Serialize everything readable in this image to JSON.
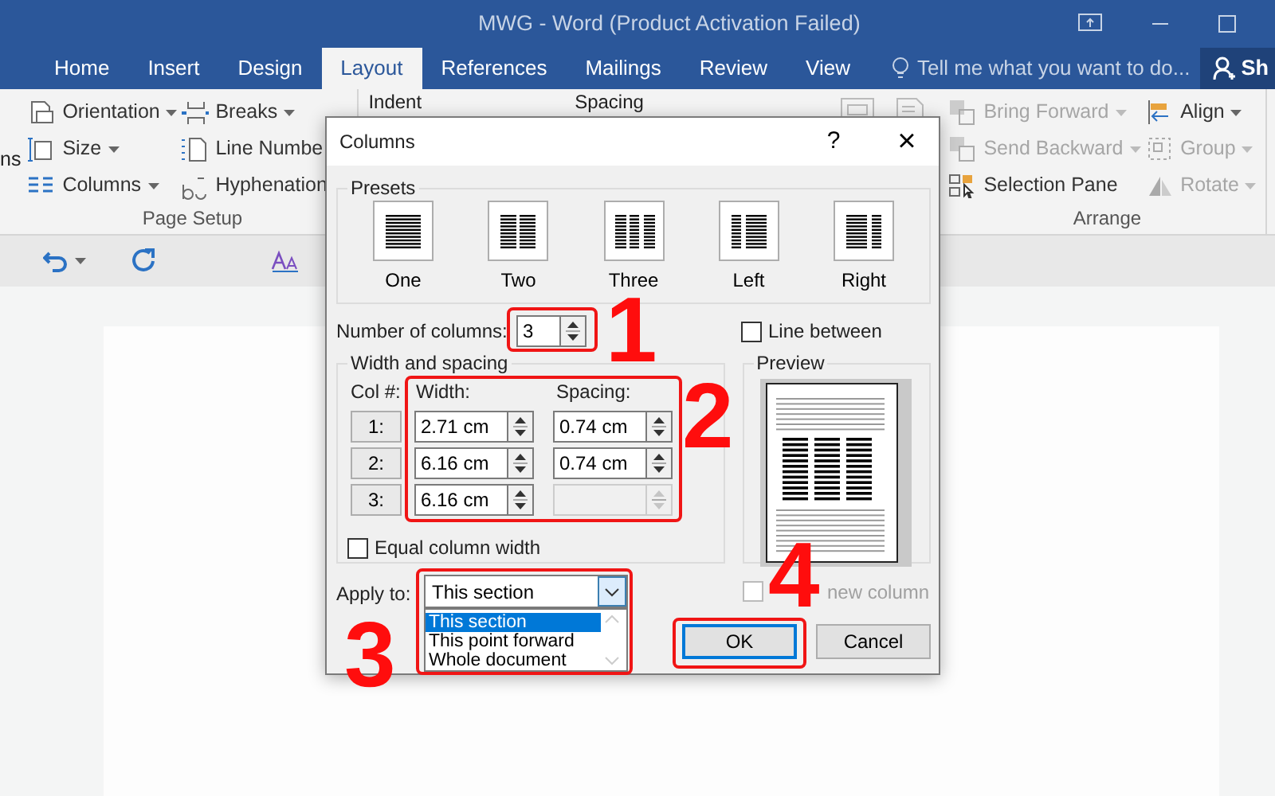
{
  "window": {
    "title": "MWG - Word (Product Activation Failed)"
  },
  "tabs": [
    {
      "label": "Home",
      "selected": false
    },
    {
      "label": "Insert",
      "selected": false
    },
    {
      "label": "Design",
      "selected": false
    },
    {
      "label": "Layout",
      "selected": true
    },
    {
      "label": "References",
      "selected": false
    },
    {
      "label": "Mailings",
      "selected": false
    },
    {
      "label": "Review",
      "selected": false
    },
    {
      "label": "View",
      "selected": false
    }
  ],
  "tell_me": {
    "placeholder": "Tell me what you want to do..."
  },
  "share": {
    "label": "Sh"
  },
  "ribbon": {
    "left_cut": "ns",
    "page_setup": {
      "label": "Page Setup",
      "items": [
        {
          "kind": "orientation",
          "label": "Orientation",
          "menu": true,
          "disabled": false
        },
        {
          "kind": "size",
          "label": "Size",
          "menu": true,
          "disabled": false
        },
        {
          "kind": "columns",
          "label": "Columns",
          "menu": true,
          "disabled": false
        },
        {
          "kind": "breaks",
          "label": "Breaks",
          "menu": true,
          "disabled": false
        },
        {
          "kind": "line-numbers",
          "label": "Line Numbe",
          "menu": false,
          "disabled": false
        },
        {
          "kind": "hyphenation",
          "label": "Hyphenation",
          "menu": false,
          "disabled": false
        }
      ]
    },
    "paragraph": {
      "headings": [
        "Indent",
        "Spacing"
      ]
    },
    "arrange": {
      "label": "Arrange",
      "items": [
        {
          "kind": "bring-forward",
          "label": "Bring Forward",
          "menu": true,
          "disabled": true
        },
        {
          "kind": "send-backward",
          "label": "Send Backward",
          "menu": true,
          "disabled": true
        },
        {
          "kind": "selection-pane",
          "label": "Selection Pane",
          "menu": false,
          "disabled": false
        },
        {
          "kind": "align",
          "label": "Align",
          "menu": true,
          "disabled": false
        },
        {
          "kind": "group",
          "label": "Group",
          "menu": true,
          "disabled": true
        },
        {
          "kind": "rotate",
          "label": "Rotate",
          "menu": true,
          "disabled": true
        }
      ]
    }
  },
  "dialog": {
    "title": "Columns",
    "help": "?",
    "close": "×",
    "presets": {
      "label": "Presets",
      "items": [
        {
          "kind": "one",
          "label": "One"
        },
        {
          "kind": "two",
          "label": "Two"
        },
        {
          "kind": "three",
          "label": "Three"
        },
        {
          "kind": "left",
          "label": "Left"
        },
        {
          "kind": "right",
          "label": "Right"
        }
      ]
    },
    "number_of_columns": {
      "label": "Number of columns:",
      "value": "3"
    },
    "line_between": {
      "label": "Line between",
      "checked": false
    },
    "width_and_spacing": {
      "label": "Width and spacing",
      "col_header": "Col #:",
      "width_header": "Width:",
      "spacing_header": "Spacing:",
      "rows": [
        {
          "col": "1:",
          "width": "2.71 cm",
          "spacing": "0.74 cm",
          "spacing_disabled": false
        },
        {
          "col": "2:",
          "width": "6.16 cm",
          "spacing": "0.74 cm",
          "spacing_disabled": false
        },
        {
          "col": "3:",
          "width": "6.16 cm",
          "spacing_disabled": true
        }
      ]
    },
    "equal_column_width": {
      "label": "Equal column width",
      "checked": false
    },
    "preview": {
      "label": "Preview"
    },
    "apply_to": {
      "label": "Apply to:",
      "value": "This section",
      "expanded": true,
      "options": [
        {
          "label": "This section",
          "selected": true
        },
        {
          "label": "This point forward",
          "selected": false
        },
        {
          "label": "Whole document",
          "selected": false
        }
      ]
    },
    "start_new_column": {
      "label": "new column",
      "checked": false,
      "disabled": true
    },
    "buttons": [
      {
        "label": "OK",
        "default": true
      },
      {
        "label": "Cancel",
        "default": false
      }
    ]
  },
  "annotations": [
    {
      "label": "1"
    },
    {
      "label": "2"
    },
    {
      "label": "3"
    },
    {
      "label": "4"
    }
  ]
}
